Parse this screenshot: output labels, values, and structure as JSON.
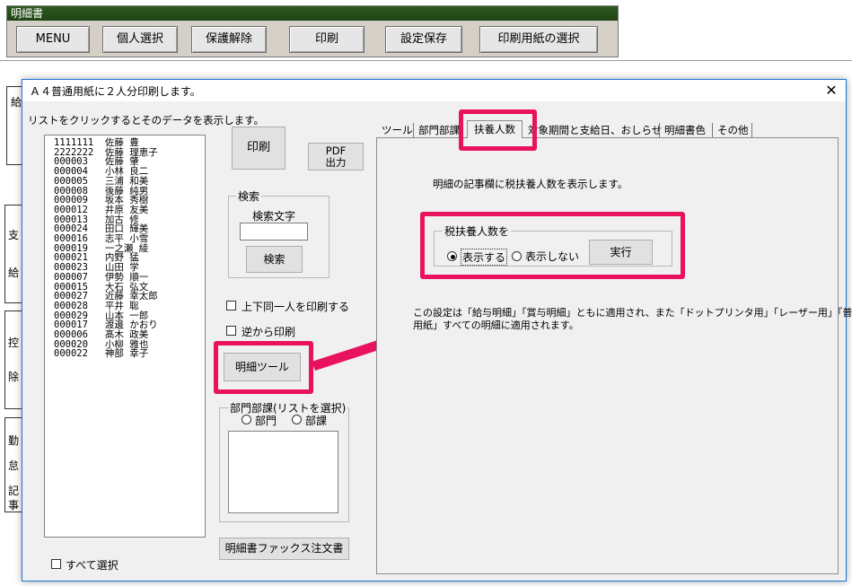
{
  "top_window": {
    "title": "明細書",
    "buttons": [
      "MENU",
      "個人選択",
      "保護解除",
      "印刷",
      "設定保存",
      "印刷用紙の選択"
    ]
  },
  "sheet_labels": {
    "kyu": "給",
    "shi": "支",
    "kyu2": "給",
    "kou": "控",
    "jo": "除",
    "kin": "勤",
    "tai": "怠",
    "ki": "記",
    "ji": "事"
  },
  "dialog": {
    "title": "Ａ４普通用紙に２人分印刷します。",
    "close_glyph": "✕",
    "list_hint": "リストをクリックするとそのデータを表示します。",
    "employees": [
      "1111111  佐藤 豊",
      "2222222  佐藤 理恵子",
      "000003   佐藤 肇",
      "000004   小林 良二",
      "000005   三浦 和美",
      "000008   後藤 純男",
      "000009   坂本 秀樹",
      "000012   井原 友美",
      "000013   加古 修",
      "000024   田口 輝美",
      "000016   志平 小雪",
      "000019   一之瀬 綾",
      "000021   内野 猛",
      "000023   山田 学",
      "000007   伊勢 順一",
      "000015   大石 弘文",
      "000027   近藤 幸太郎",
      "000028   平井 聡",
      "000029   山本 一郎",
      "000017   渡邊 かおり",
      "000006   髙木 政美",
      "000020   小柳 雅也",
      "000022   神部 幸子"
    ],
    "print_button": "印刷",
    "pdf_button_line1": "PDF",
    "pdf_button_line2": "出力",
    "search": {
      "group_label": "検索",
      "field_label": "検索文字",
      "value": "",
      "button": "検索"
    },
    "checkbox_same_person": "上下同一人を印刷する",
    "checkbox_reverse": "逆から印刷",
    "meisai_tool_button": "明細ツール",
    "dept": {
      "group_label": "部門部課(リストを選択)",
      "radio_bumon": "部門",
      "radio_bukai": "部課"
    },
    "fax_button": "明細書ファックス注文書",
    "select_all": "すべて選択",
    "tabs": [
      "ツール",
      "部門部課",
      "扶養人数",
      "対象期間と支給日、おしらせ",
      "明細書色",
      "その他"
    ],
    "active_tab": "扶養人数",
    "tab_panel": {
      "description": "明細の記事欄に税扶養人数を表示します。",
      "group_label": "税扶養人数を",
      "radio_show": "表示する",
      "radio_hide": "表示しない",
      "execute_button": "実行",
      "note_line1": "この設定は「給与明細」「賞与明細」ともに適用され、また「ドットプリンタ用」「レーザー用」「普通",
      "note_line2": "用紙」すべての明細に適用されます。"
    }
  },
  "colors": {
    "highlight": "#e8125f",
    "titlebar_green": "#2e5a1f",
    "dialog_border": "#1e74d6"
  }
}
